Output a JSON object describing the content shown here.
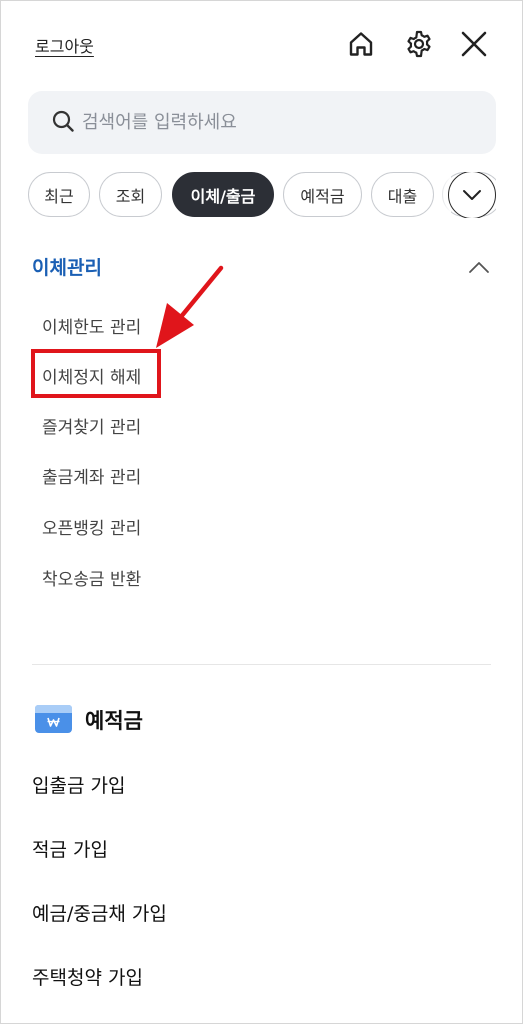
{
  "header": {
    "logout_label": "로그아웃",
    "icons": [
      "home-icon",
      "gear-icon",
      "close-icon"
    ]
  },
  "search": {
    "placeholder": "검색어를 입력하세요"
  },
  "categories": [
    {
      "label": "최근",
      "active": false
    },
    {
      "label": "조회",
      "active": false
    },
    {
      "label": "이체/출금",
      "active": true
    },
    {
      "label": "예적금",
      "active": false
    },
    {
      "label": "대출",
      "active": false
    }
  ],
  "transfer_section": {
    "title": "이체관리",
    "items": [
      {
        "label": "이체한도 관리"
      },
      {
        "label": "이체정지 해제",
        "highlighted": true
      },
      {
        "label": "즐겨찾기 관리"
      },
      {
        "label": "출금계좌 관리"
      },
      {
        "label": "오픈뱅킹 관리"
      },
      {
        "label": "착오송금 반환"
      }
    ]
  },
  "deposit_section": {
    "title": "예적금",
    "items": [
      {
        "label": "입출금 가입"
      },
      {
        "label": "적금 가입"
      },
      {
        "label": "예금/중금채 가입"
      },
      {
        "label": "주택청약 가입"
      }
    ]
  },
  "colors": {
    "accent_blue": "#1a5fb4",
    "active_chip": "#2c2f36",
    "highlight_red": "#e0151b"
  }
}
